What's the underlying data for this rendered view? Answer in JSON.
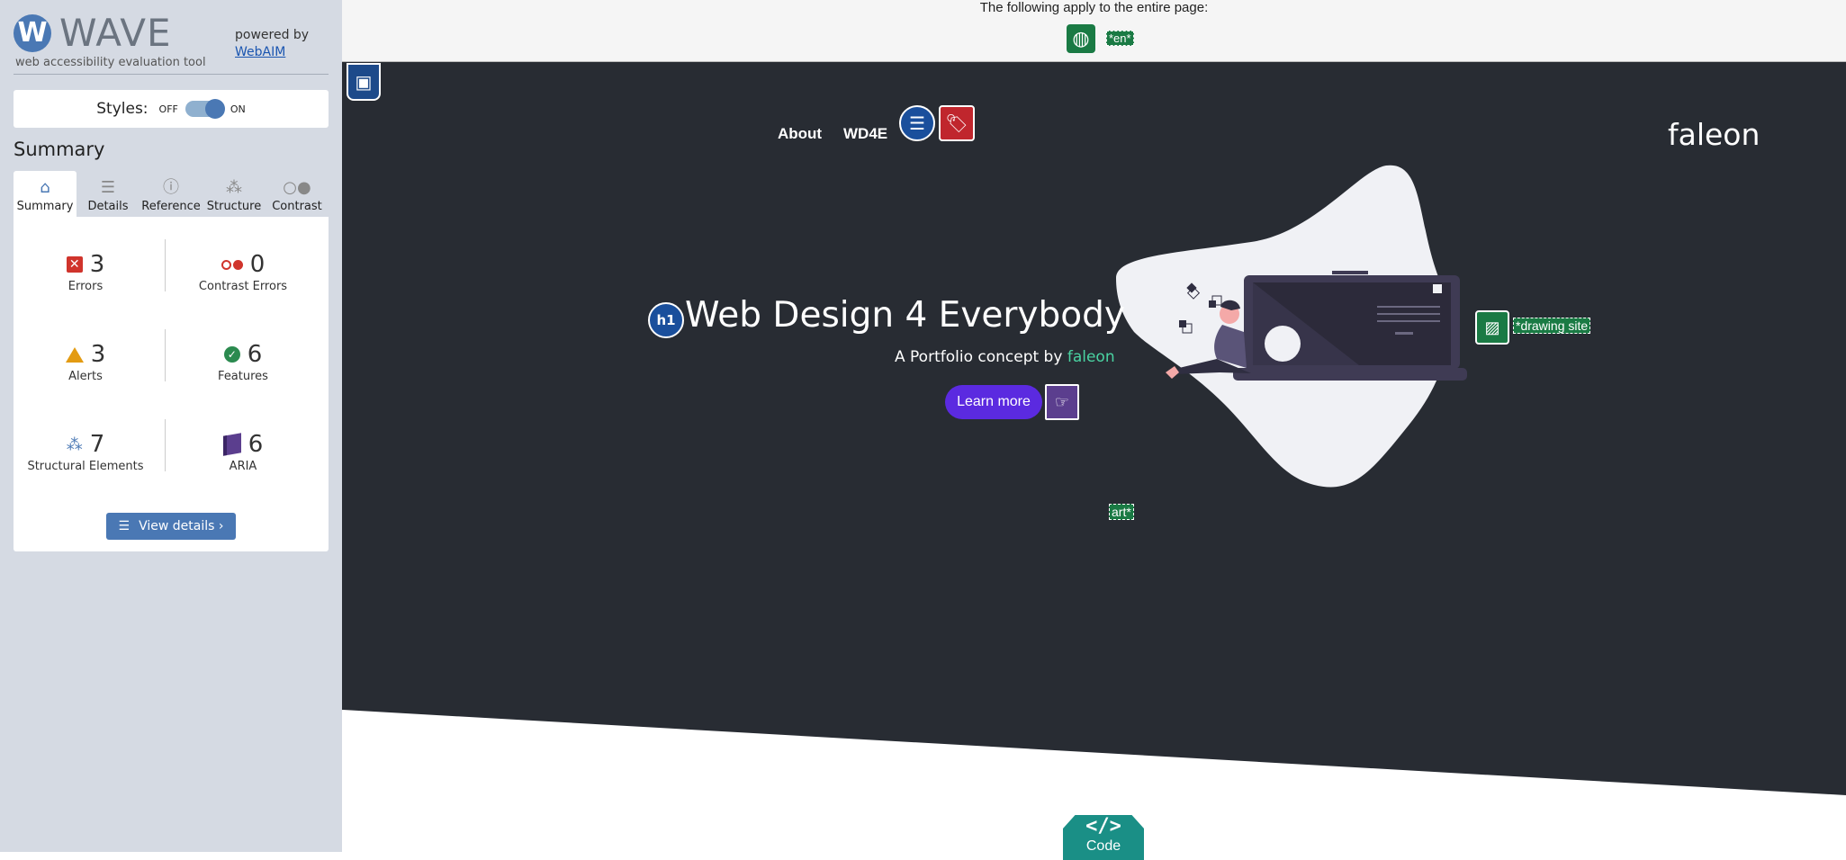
{
  "wave": {
    "logo_letter": "W",
    "logo_text": "WAVE",
    "tagline": "web accessibility evaluation tool",
    "powered_by": "powered by",
    "webaim_link": "WebAIM",
    "styles_label": "Styles:",
    "styles_off": "OFF",
    "styles_on": "ON",
    "summary_heading": "Summary",
    "tabs": [
      {
        "label": "Summary",
        "icon": "home-icon"
      },
      {
        "label": "Details",
        "icon": "list-icon"
      },
      {
        "label": "Reference",
        "icon": "info-icon"
      },
      {
        "label": "Structure",
        "icon": "hierarchy-icon"
      },
      {
        "label": "Contrast",
        "icon": "contrast-icon"
      }
    ],
    "stats": {
      "errors": {
        "count": "3",
        "label": "Errors"
      },
      "contrast_errors": {
        "count": "0",
        "label": "Contrast Errors"
      },
      "alerts": {
        "count": "3",
        "label": "Alerts"
      },
      "features": {
        "count": "6",
        "label": "Features"
      },
      "structural": {
        "count": "7",
        "label": "Structural Elements"
      },
      "aria": {
        "count": "6",
        "label": "ARIA"
      }
    },
    "view_details": "View details ›"
  },
  "page_banner": {
    "text": "The following apply to the entire page:",
    "lang_tag": "*en*"
  },
  "site": {
    "nav": [
      "About",
      "WD4E"
    ],
    "brand": "faleon",
    "hero_title": "Web Design 4 Everybody",
    "hero_sub_prefix": "A Portfolio concept by ",
    "hero_sub_link": "faleon",
    "learn_more": "Learn more",
    "alt_text_1": "*drawing site",
    "alt_text_2": "art*",
    "h1_badge": "h1",
    "code_badge_symbol": "</>",
    "code_badge_label": "Code"
  },
  "colors": {
    "hero_bg": "#282c33",
    "accent_green": "#4ad3a2",
    "button_purple": "#5b2ae0",
    "wave_blue": "#4a78b4"
  }
}
